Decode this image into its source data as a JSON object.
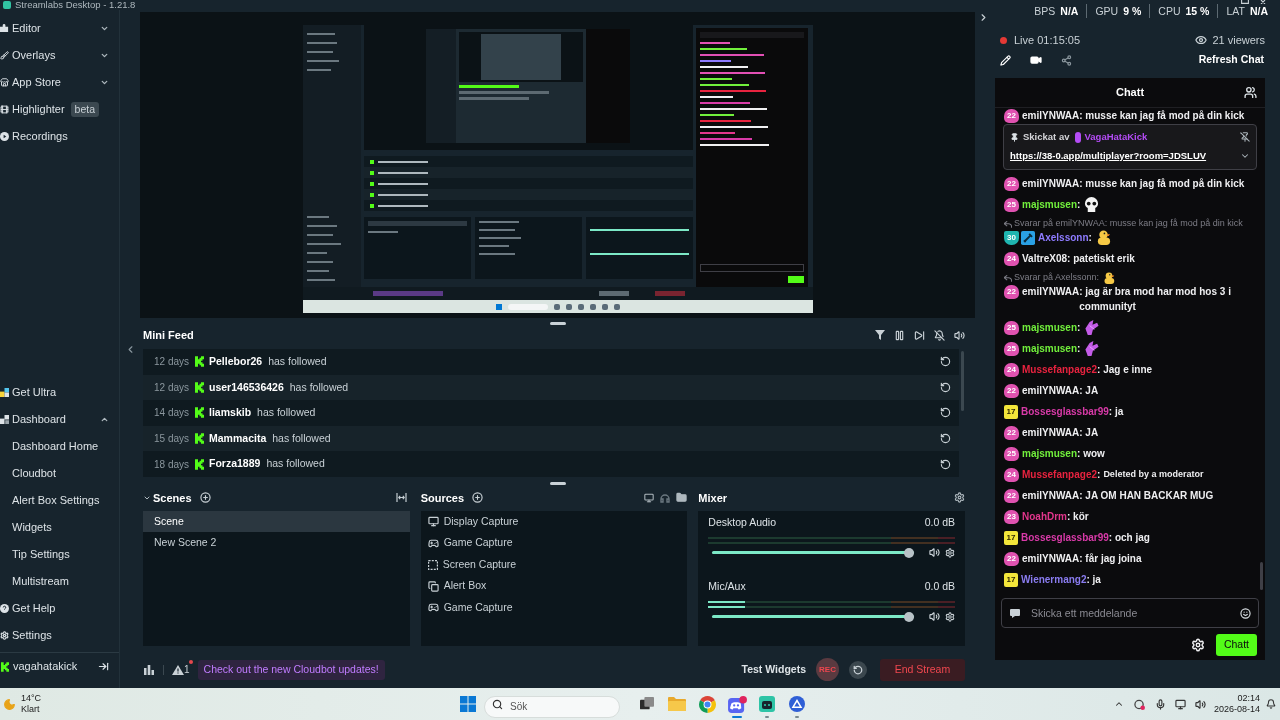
{
  "title_bar": {
    "title": "Streamlabs Desktop - 1.21.8"
  },
  "sidebar": {
    "nav": [
      {
        "kind": "group",
        "label": "Editor",
        "expanded": false
      },
      {
        "kind": "group",
        "label": "Overlays",
        "expanded": false
      },
      {
        "kind": "group",
        "label": "App Store",
        "expanded": false
      },
      {
        "kind": "link",
        "label": "Highlighter",
        "badge": "beta"
      },
      {
        "kind": "link",
        "label": "Recordings"
      }
    ],
    "bottom_nav": [
      {
        "kind": "link",
        "label": "Get Ultra"
      },
      {
        "kind": "group",
        "label": "Dashboard",
        "expanded": true,
        "children": [
          {
            "label": "Dashboard Home"
          },
          {
            "label": "Cloudbot"
          },
          {
            "label": "Alert Box Settings"
          },
          {
            "label": "Widgets"
          },
          {
            "label": "Tip Settings"
          },
          {
            "label": "Multistream"
          }
        ]
      },
      {
        "kind": "link",
        "label": "Get Help"
      },
      {
        "kind": "link",
        "label": "Settings"
      }
    ],
    "account": {
      "name": "vagahatakick"
    }
  },
  "mini_feed": {
    "title": "Mini Feed",
    "events": [
      {
        "time": "12 days",
        "name": "Pellebor26",
        "action": "has followed"
      },
      {
        "time": "12 days",
        "name": "user146536426",
        "action": "has followed"
      },
      {
        "time": "14 days",
        "name": "liamskib",
        "action": "has followed"
      },
      {
        "time": "15 days",
        "name": "Mammacita",
        "action": "has followed"
      },
      {
        "time": "18 days",
        "name": "Forza1889",
        "action": "has followed"
      }
    ]
  },
  "scenes": {
    "title": "Scenes",
    "items": [
      {
        "name": "Scene",
        "selected": true
      },
      {
        "name": "New Scene 2",
        "selected": false
      }
    ]
  },
  "sources": {
    "title": "Sources",
    "items": [
      {
        "name": "Display Capture",
        "kind": "display"
      },
      {
        "name": "Game Capture",
        "kind": "game"
      },
      {
        "name": "Screen Capture",
        "kind": "screen"
      },
      {
        "name": "Alert Box",
        "kind": "alert"
      },
      {
        "name": "Game Capture",
        "kind": "game"
      }
    ]
  },
  "mixer": {
    "title": "Mixer",
    "channels": [
      {
        "name": "Desktop Audio",
        "reading": "0.0 dB",
        "meter": {
          "level": 0
        },
        "volume": {
          "level": 1
        }
      },
      {
        "name": "Mic/Aux",
        "reading": "0.0 dB",
        "meter": {
          "level": 0.15
        },
        "volume": {
          "level": 1
        }
      }
    ]
  },
  "bottom_bar": {
    "alert_count": "1",
    "notice": "Check out the new Cloudbot updates!",
    "test_widgets": "Test Widgets",
    "rec": "REC",
    "end_stream": "End Stream"
  },
  "stats": [
    {
      "label": "BPS",
      "value": "N/A"
    },
    {
      "label": "GPU",
      "value": "9 %"
    },
    {
      "label": "CPU",
      "value": "15 %"
    },
    {
      "label": "LAT",
      "value": "N/A"
    }
  ],
  "stream": {
    "status": "Live 01:15:05",
    "viewers": "21 viewers",
    "refresh": "Refresh Chat"
  },
  "chat": {
    "title": "Chatt",
    "pinned": {
      "sent_by": "Skickat av",
      "author": "VagaHataKick",
      "link": "https://38-0.app/multiplayer?room=JDSLUV"
    },
    "messages": [
      {
        "kind": "text",
        "badges": [
          {
            "kind": "sub",
            "text": "22"
          }
        ],
        "user": "emilYNWAA",
        "color": "#f0f0f2",
        "text": ": musse kan jag få mod på din kick"
      },
      {
        "kind": "text",
        "badges": [
          {
            "kind": "sub",
            "text": "22"
          }
        ],
        "user": "emilYNWAA",
        "color": "#f0f0f2",
        "text": ": musse kan jag få mod på din kick"
      },
      {
        "kind": "emote",
        "badges": [
          {
            "kind": "sub",
            "text": "25"
          }
        ],
        "user": "majsmusen",
        "color": "#72f03c",
        "text": ":",
        "emote": {
          "kind": "skull"
        }
      },
      {
        "kind": "emote",
        "reply": {
          "text": "Svarar på emilYNWAA: musse kan jag få mod på din kick"
        },
        "badges": [
          {
            "kind": "shield",
            "text": "30"
          },
          {
            "kind": "mod"
          }
        ],
        "user": "Axelssonn",
        "color": "#8e7bff",
        "text": ":",
        "emote": {
          "kind": "duck"
        }
      },
      {
        "kind": "text",
        "badges": [
          {
            "kind": "sub",
            "text": "24"
          }
        ],
        "user": "ValtreX08",
        "color": "#f0f0f2",
        "text": ": patetiskt erik"
      },
      {
        "kind": "text",
        "reply": {
          "text": "Svarar på Axelssonn:",
          "emote": {
            "kind": "duck"
          }
        },
        "badges": [
          {
            "kind": "sub",
            "text": "22"
          }
        ],
        "user": "emilYNWAA",
        "color": "#f0f0f2",
        "text": ": jag är bra mod har mod hos 3 i communityt"
      },
      {
        "kind": "emote",
        "badges": [
          {
            "kind": "sub",
            "text": "25"
          }
        ],
        "user": "majsmusen",
        "color": "#72f03c",
        "text": ":",
        "emote": {
          "kind": "hand"
        }
      },
      {
        "kind": "emote",
        "badges": [
          {
            "kind": "sub",
            "text": "25"
          }
        ],
        "user": "majsmusen",
        "color": "#72f03c",
        "text": ":",
        "emote": {
          "kind": "hand"
        }
      },
      {
        "kind": "text",
        "badges": [
          {
            "kind": "sub",
            "text": "24"
          }
        ],
        "user": "Mussefanpage2",
        "color": "#e8233f",
        "text": ": Jag e inne"
      },
      {
        "kind": "text",
        "badges": [
          {
            "kind": "sub",
            "text": "22"
          }
        ],
        "user": "emilYNWAA",
        "color": "#f0f0f2",
        "text": ": JA"
      },
      {
        "kind": "text",
        "badges": [
          {
            "kind": "tier",
            "text": "17"
          }
        ],
        "user": "Bossesglassbar99",
        "color": "#d93aa8",
        "text": ": ja"
      },
      {
        "kind": "text",
        "badges": [
          {
            "kind": "sub",
            "text": "22"
          }
        ],
        "user": "emilYNWAA",
        "color": "#f0f0f2",
        "text": ": JA"
      },
      {
        "kind": "text",
        "badges": [
          {
            "kind": "sub",
            "text": "25"
          }
        ],
        "user": "majsmusen",
        "color": "#72f03c",
        "text": ": wow"
      },
      {
        "kind": "deleted",
        "badges": [
          {
            "kind": "sub",
            "text": "24"
          }
        ],
        "user": "Mussefanpage2",
        "color": "#e8233f",
        "text": ":",
        "note": "Deleted by a moderator"
      },
      {
        "kind": "text",
        "badges": [
          {
            "kind": "sub",
            "text": "22"
          }
        ],
        "user": "emilYNWAA",
        "color": "#f0f0f2",
        "text": ": JA OM HAN BACKAR MUG"
      },
      {
        "kind": "text",
        "badges": [
          {
            "kind": "sub",
            "text": "23"
          }
        ],
        "user": "NoahDrm",
        "color": "#e2368c",
        "text": ": kör"
      },
      {
        "kind": "text",
        "badges": [
          {
            "kind": "tier",
            "text": "17"
          }
        ],
        "user": "Bossesglassbar99",
        "color": "#d93aa8",
        "text": ": och jag"
      },
      {
        "kind": "text",
        "badges": [
          {
            "kind": "sub",
            "text": "22"
          }
        ],
        "user": "emilYNWAA",
        "color": "#f0f0f2",
        "text": ": får jag joina"
      },
      {
        "kind": "text",
        "badges": [
          {
            "kind": "tier",
            "text": "17"
          }
        ],
        "user": "Wienermang2",
        "color": "#8a7cf0",
        "text": ": ja"
      }
    ],
    "input": {
      "placeholder": "Skicka ett meddelande"
    },
    "send": "Chatt"
  },
  "taskbar": {
    "weather": {
      "temperature": "14°C",
      "condition": "Klart"
    },
    "search": {
      "placeholder": "Sök"
    },
    "apps": [
      {
        "running": false
      },
      {
        "running": false
      },
      {
        "running": false
      },
      {
        "running": true
      },
      {
        "running": true
      },
      {
        "running": true
      }
    ],
    "clock": {
      "time": "02:14",
      "date": "2026-08-14"
    }
  }
}
